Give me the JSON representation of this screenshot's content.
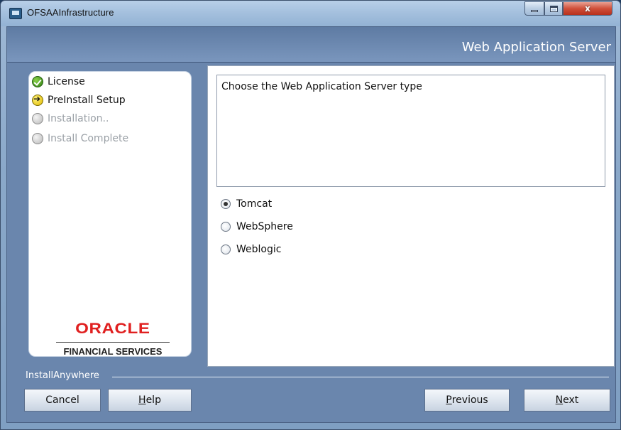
{
  "window": {
    "title": "OFSAAInfrastructure",
    "close_glyph": "x",
    "icon": "app-icon"
  },
  "header": {
    "title": "Web Application Server"
  },
  "steps": [
    {
      "label": "License",
      "state": "done"
    },
    {
      "label": "PreInstall Setup",
      "state": "current"
    },
    {
      "label": "Installation..",
      "state": "todo"
    },
    {
      "label": "Install Complete",
      "state": "todo"
    }
  ],
  "logo": {
    "brand": "ORACLE",
    "subtitle": "FINANCIAL SERVICES",
    "brand_color": "#e02020"
  },
  "main": {
    "description": "Choose the Web Application Server type",
    "options": [
      {
        "label": "Tomcat",
        "selected": true
      },
      {
        "label": "WebSphere",
        "selected": false
      },
      {
        "label": "Weblogic",
        "selected": false
      }
    ]
  },
  "footer": {
    "label": "InstallAnywhere",
    "buttons": {
      "cancel": {
        "before": "",
        "accel": "",
        "after": "Cancel"
      },
      "help": {
        "before": "",
        "accel": "H",
        "after": "elp"
      },
      "previous": {
        "before": "",
        "accel": "P",
        "after": "revious"
      },
      "next": {
        "before": "",
        "accel": "N",
        "after": "ext"
      }
    }
  }
}
